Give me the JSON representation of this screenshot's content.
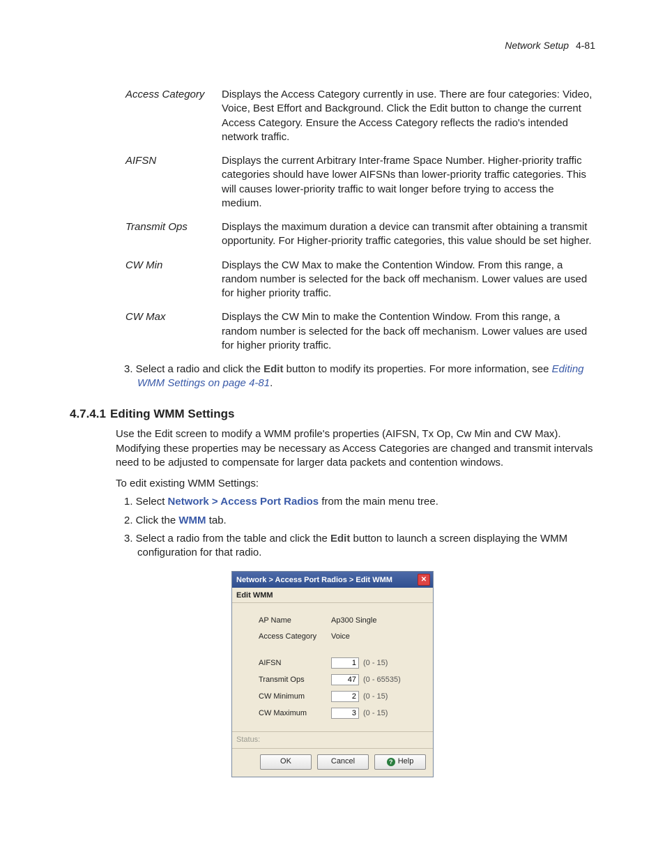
{
  "header": {
    "section": "Network Setup",
    "page": "4-81"
  },
  "defs": [
    {
      "label": "Access Category",
      "desc": "Displays the Access Category currently in use. There are four categories: Video, Voice, Best Effort and Background. Click the Edit button to change the current Access Category. Ensure the Access Category reflects the radio's intended network traffic."
    },
    {
      "label": "AIFSN",
      "desc": "Displays the current Arbitrary Inter-frame Space Number. Higher-priority traffic categories should have lower AIFSNs than lower-priority traffic categories. This will causes lower-priority traffic to wait longer before trying to access the medium."
    },
    {
      "label": "Transmit Ops",
      "desc": "Displays the maximum duration a device can transmit after obtaining a transmit opportunity. For Higher-priority traffic categories, this value should be set higher."
    },
    {
      "label": "CW Min",
      "desc": "Displays the CW Max to make the Contention Window. From this range, a random number is selected for the back off mechanism. Lower values are used for higher priority traffic."
    },
    {
      "label": "CW Max",
      "desc": "Displays the CW Min to make the Contention Window. From this range, a random number is selected for the back off mechanism. Lower values are used for higher priority traffic."
    }
  ],
  "step3": {
    "pre": "3. Select a radio and click the ",
    "edit": "Edit",
    "mid": " button to modify its properties. For more information, see ",
    "link": "Editing WMM Settings on page 4-81",
    "post": "."
  },
  "sec": {
    "num": "4.7.4.1",
    "title": "Editing WMM Settings"
  },
  "p1": "Use the Edit screen to modify a WMM profile's properties (AIFSN, Tx Op, Cw Min and CW Max). Modifying these properties may be necessary as Access Categories are changed and transmit intervals need to be adjusted to compensate for larger data packets and contention windows.",
  "p2": "To edit existing WMM Settings:",
  "steps": {
    "s1_pre": "1. Select ",
    "s1_nav": "Network > Access Port Radios",
    "s1_post": " from the main menu tree.",
    "s2_pre": "2. Click the ",
    "s2_tab": "WMM",
    "s2_post": " tab.",
    "s3_pre": "3. Select a radio from the table and click the ",
    "s3_edit": "Edit",
    "s3_post": " button to launch a screen displaying the WMM configuration for that radio."
  },
  "dialog": {
    "title": "Network > Access Port Radios > Edit WMM",
    "subtitle": "Edit WMM",
    "rows": {
      "apname_lbl": "AP Name",
      "apname_val": "Ap300 Single",
      "ac_lbl": "Access Category",
      "ac_val": "Voice",
      "aifsn_lbl": "AIFSN",
      "aifsn_val": "1",
      "aifsn_range": "(0 - 15)",
      "txop_lbl": "Transmit Ops",
      "txop_val": "47",
      "txop_range": "(0 - 65535)",
      "cwmin_lbl": "CW Minimum",
      "cwmin_val": "2",
      "cwmin_range": "(0 - 15)",
      "cwmax_lbl": "CW Maximum",
      "cwmax_val": "3",
      "cwmax_range": "(0 - 15)"
    },
    "status_lbl": "Status:",
    "buttons": {
      "ok": "OK",
      "cancel": "Cancel",
      "help": "Help"
    }
  }
}
